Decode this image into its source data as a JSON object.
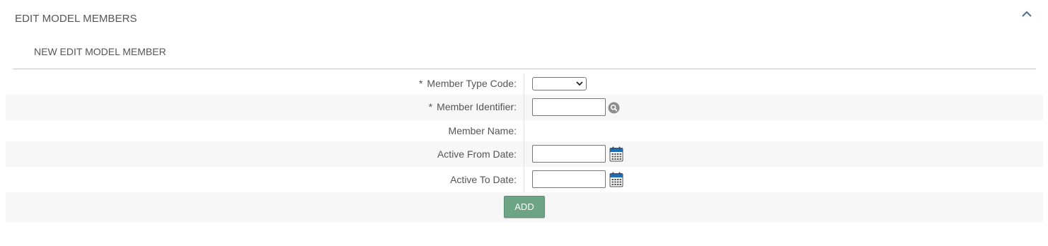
{
  "header": {
    "title": "EDIT MODEL MEMBERS",
    "collapse_icon": "chevron-up-icon"
  },
  "subtitle": "NEW EDIT MODEL MEMBER",
  "form": {
    "member_type_code": {
      "required_mark": "*",
      "label": "Member Type Code:",
      "value": ""
    },
    "member_identifier": {
      "required_mark": "*",
      "label": "Member Identifier:",
      "value": "",
      "icon": "search-icon"
    },
    "member_name": {
      "label": "Member Name:",
      "value": ""
    },
    "active_from_date": {
      "label": "Active From Date:",
      "value": "",
      "icon": "calendar-icon"
    },
    "active_to_date": {
      "label": "Active To Date:",
      "value": "",
      "icon": "calendar-icon"
    }
  },
  "add_button": {
    "label": "ADD",
    "color": "#6ea486"
  },
  "colors": {
    "row_alt": "#f7f7f7",
    "text": "#555555",
    "icon_blue": "#1e6fb8"
  }
}
